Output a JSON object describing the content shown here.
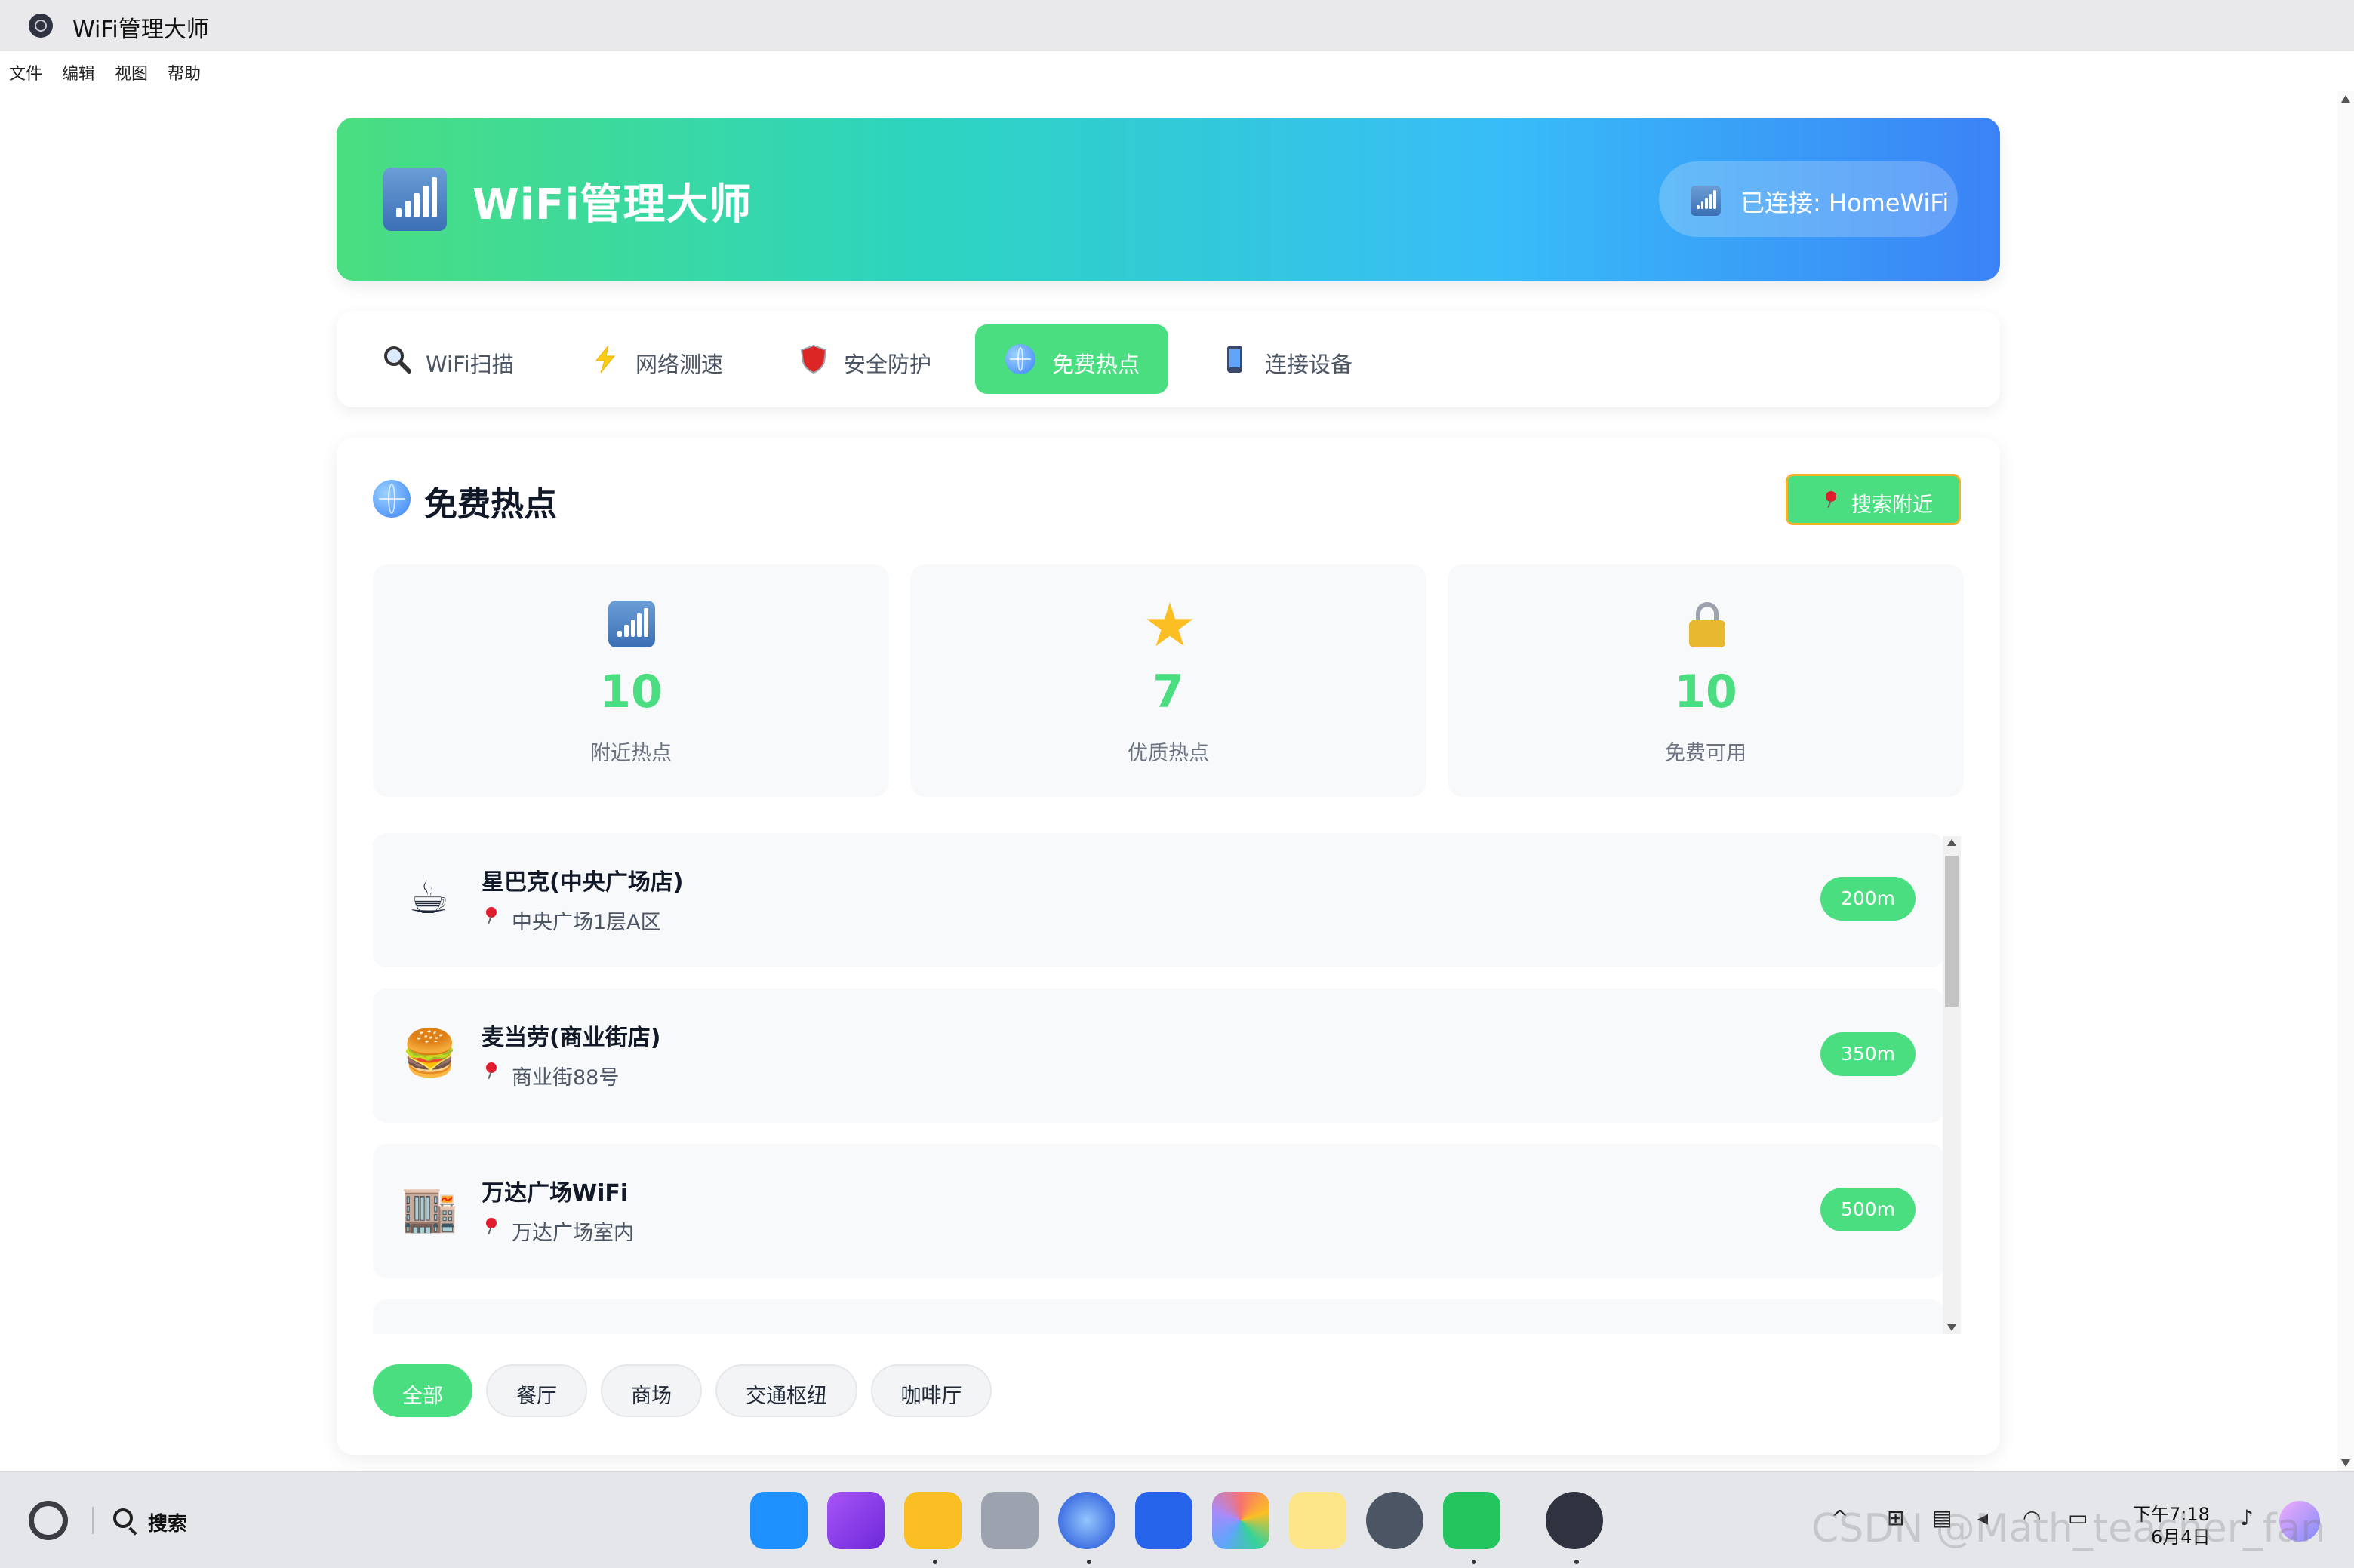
{
  "window": {
    "title": "WiFi管理大师"
  },
  "menu": [
    "文件",
    "编辑",
    "视图",
    "帮助"
  ],
  "header": {
    "title": "WiFi管理大师",
    "status": "已连接: HomeWiFi"
  },
  "tabs": [
    {
      "label": "WiFi扫描",
      "icon": "magnifier-icon",
      "active": false
    },
    {
      "label": "网络测速",
      "icon": "lightning-icon",
      "active": false
    },
    {
      "label": "安全防护",
      "icon": "shield-icon",
      "active": false
    },
    {
      "label": "免费热点",
      "icon": "globe-icon",
      "active": true
    },
    {
      "label": "连接设备",
      "icon": "phone-icon",
      "active": false
    }
  ],
  "section": {
    "title": "免费热点",
    "search_button": "搜索附近"
  },
  "stats": [
    {
      "value": "10",
      "label": "附近热点",
      "icon": "signal-icon"
    },
    {
      "value": "7",
      "label": "优质热点",
      "icon": "star-icon"
    },
    {
      "value": "10",
      "label": "免费可用",
      "icon": "lock-icon"
    }
  ],
  "hotspots": [
    {
      "name": "星巴克(中央广场店)",
      "address": "中央广场1层A区",
      "distance": "200m",
      "icon": "☕"
    },
    {
      "name": "麦当劳(商业街店)",
      "address": "商业街88号",
      "distance": "350m",
      "icon": "🍔"
    },
    {
      "name": "万达广场WiFi",
      "address": "万达广场室内",
      "distance": "500m",
      "icon": "🏬"
    }
  ],
  "filters": [
    {
      "label": "全部",
      "active": true
    },
    {
      "label": "餐厅",
      "active": false
    },
    {
      "label": "商场",
      "active": false
    },
    {
      "label": "交通枢纽",
      "active": false
    },
    {
      "label": "咖啡厅",
      "active": false
    }
  ],
  "taskbar": {
    "search_label": "搜索",
    "time": "下午7:18",
    "date": "6月4日"
  },
  "watermark": "CSDN @Math_teacher_fan",
  "colors": {
    "accent_green": "#4ade80",
    "header_gradient_start": "#4ade80",
    "header_gradient_end": "#3b82f6",
    "search_button_border": "#f0b429"
  }
}
